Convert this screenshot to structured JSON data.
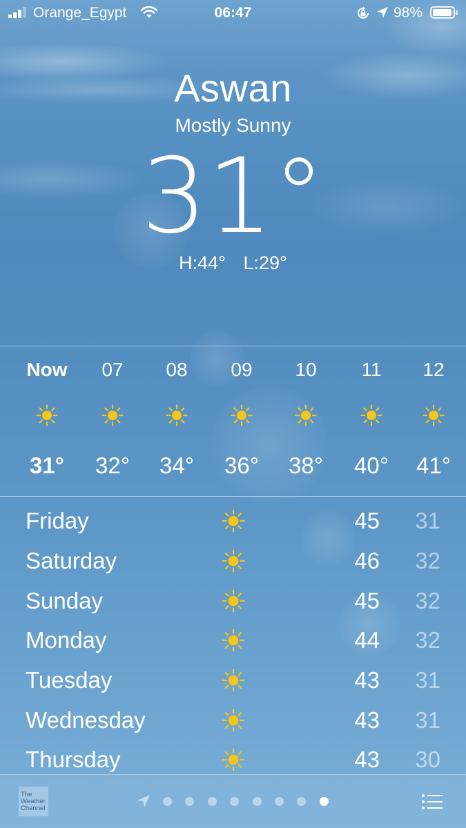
{
  "status_bar": {
    "carrier": "Orange_Egypt",
    "time": "06:47",
    "battery_percent": "98%",
    "battery_level": 0.98,
    "signal_bars": 3,
    "icons": [
      "signal-icon",
      "wifi-icon",
      "orientation-lock-icon",
      "location-arrow-icon",
      "battery-icon"
    ]
  },
  "current": {
    "city": "Aswan",
    "condition": "Mostly Sunny",
    "temperature": "31°",
    "high": "H:44°",
    "low": "L:29°"
  },
  "hourly": [
    {
      "time": "Now",
      "icon": "sun-icon",
      "temp": "31°",
      "current": true
    },
    {
      "time": "07",
      "icon": "sun-icon",
      "temp": "32°",
      "current": false
    },
    {
      "time": "08",
      "icon": "sun-icon",
      "temp": "34°",
      "current": false
    },
    {
      "time": "09",
      "icon": "sun-icon",
      "temp": "36°",
      "current": false
    },
    {
      "time": "10",
      "icon": "sun-icon",
      "temp": "38°",
      "current": false
    },
    {
      "time": "11",
      "icon": "sun-icon",
      "temp": "40°",
      "current": false
    },
    {
      "time": "12",
      "icon": "sun-icon",
      "temp": "41°",
      "current": false
    }
  ],
  "daily": [
    {
      "day": "Friday",
      "icon": "sun-icon",
      "high": "45",
      "low": "31"
    },
    {
      "day": "Saturday",
      "icon": "sun-icon",
      "high": "46",
      "low": "32"
    },
    {
      "day": "Sunday",
      "icon": "sun-icon",
      "high": "45",
      "low": "32"
    },
    {
      "day": "Monday",
      "icon": "sun-icon",
      "high": "44",
      "low": "32"
    },
    {
      "day": "Tuesday",
      "icon": "sun-icon",
      "high": "43",
      "low": "31"
    },
    {
      "day": "Wednesday",
      "icon": "sun-icon",
      "high": "43",
      "low": "31"
    },
    {
      "day": "Thursday",
      "icon": "sun-icon",
      "high": "43",
      "low": "30"
    }
  ],
  "toolbar": {
    "provider_logo": [
      "The",
      "Weather",
      "Channel"
    ],
    "page_count": 8,
    "active_page": 8
  },
  "colors": {
    "sun": "#f5c518",
    "low_temp": "rgba(255,255,255,0.55)",
    "text": "#ffffff"
  }
}
